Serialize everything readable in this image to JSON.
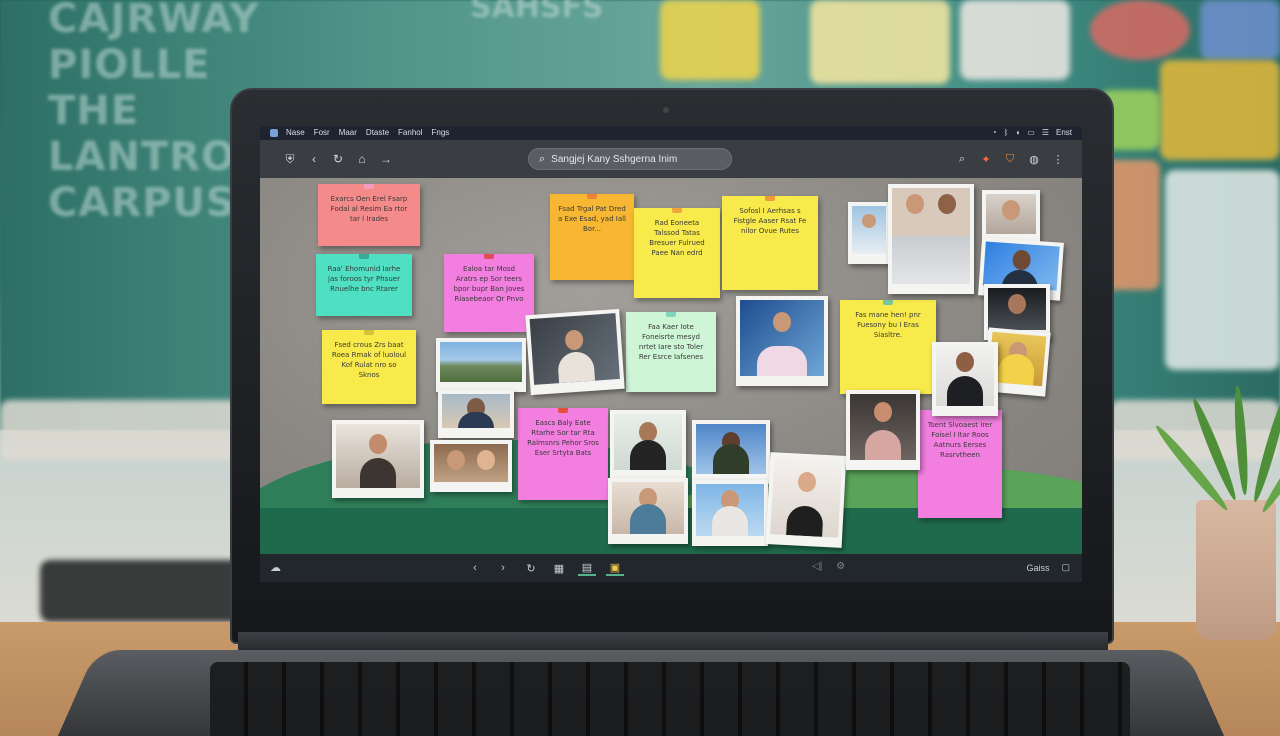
{
  "backdrop": {
    "wall_heading": "CAJRWAY PIOLLE THE LANTROAM CARPUS",
    "wall_heading_b": "SAHSFS"
  },
  "menubar": {
    "items": [
      "Nase",
      "Fosr",
      "Maar",
      "Dtaste",
      "Fanhol",
      "Fngs"
    ],
    "tray_label": "Enst"
  },
  "browser": {
    "search_text": "Sangjej Kany Sshgerna Inim"
  },
  "notes": [
    {
      "text": "Exarcs Oen Erel Fsarp Fodal al Resim Ea rtor tar l Irades"
    },
    {
      "text": "Raa' Ehomunid Iarhe jas foroos tyr Phsuer Rnuelhe bnc Rtarer"
    },
    {
      "text": "Fsed crous Zrs baat Roea Rmak of luoloul Kof Rulat nro so Sknos"
    },
    {
      "text": "Ealoa tar Mosd Aratrs ep Sor teers bpor bupr Ban Joves Riasebeaor Qr Pnvo"
    },
    {
      "text": "Fsad Trgal Pat Dred a Exe Esad, yad Iall Bor..."
    },
    {
      "text": "Rad Eoneeta Talssod Tatas Bresuer Fulrued Paee Nan edrd"
    },
    {
      "text": "Sofosl I Aerhsas s Fistgle Aaser Rsat Fe nilor Ovue Rutes"
    },
    {
      "text": "Faa Kaer Iote Foneisrte mesyd nrtet Iare sto Toler Rer Esrce Iafsenes"
    },
    {
      "text": "Fas mane hen! pnr Fuesony bu I Eras Siasltre."
    },
    {
      "text": "Eascs Baly Eate Rtarhe Sor tar Rta Ralmsnrs Pehor Sros Eser Srtyta Bats"
    },
    {
      "text": "Tsent Slvoaest Irer Foisel I Itar Roos Aatnurs Eerses Rasrvtheen"
    }
  ],
  "colors": {
    "note_pink": "#f48a8a",
    "note_teal": "#4fe0c3",
    "note_yellow": "#f8ea4a",
    "note_magenta": "#f27fe0",
    "note_orange": "#f7b733",
    "note_mint": "#cdf5d6",
    "accent_green": "#59b38a"
  },
  "icons": {
    "nav": [
      "shield-icon",
      "back-icon",
      "reload-icon",
      "home-icon",
      "forward-icon"
    ],
    "browser_right": [
      "search-icon",
      "notification-icon",
      "shield-icon",
      "palette-icon",
      "more-icon"
    ],
    "taskbar": [
      "cloud-icon",
      "prev-icon",
      "next-icon",
      "refresh-icon",
      "grid-icon",
      "board-icon",
      "photo-icon",
      "audio-icon",
      "settings-icon",
      "window-icon"
    ]
  },
  "taskbar": {
    "right_label": "Gaiss"
  }
}
